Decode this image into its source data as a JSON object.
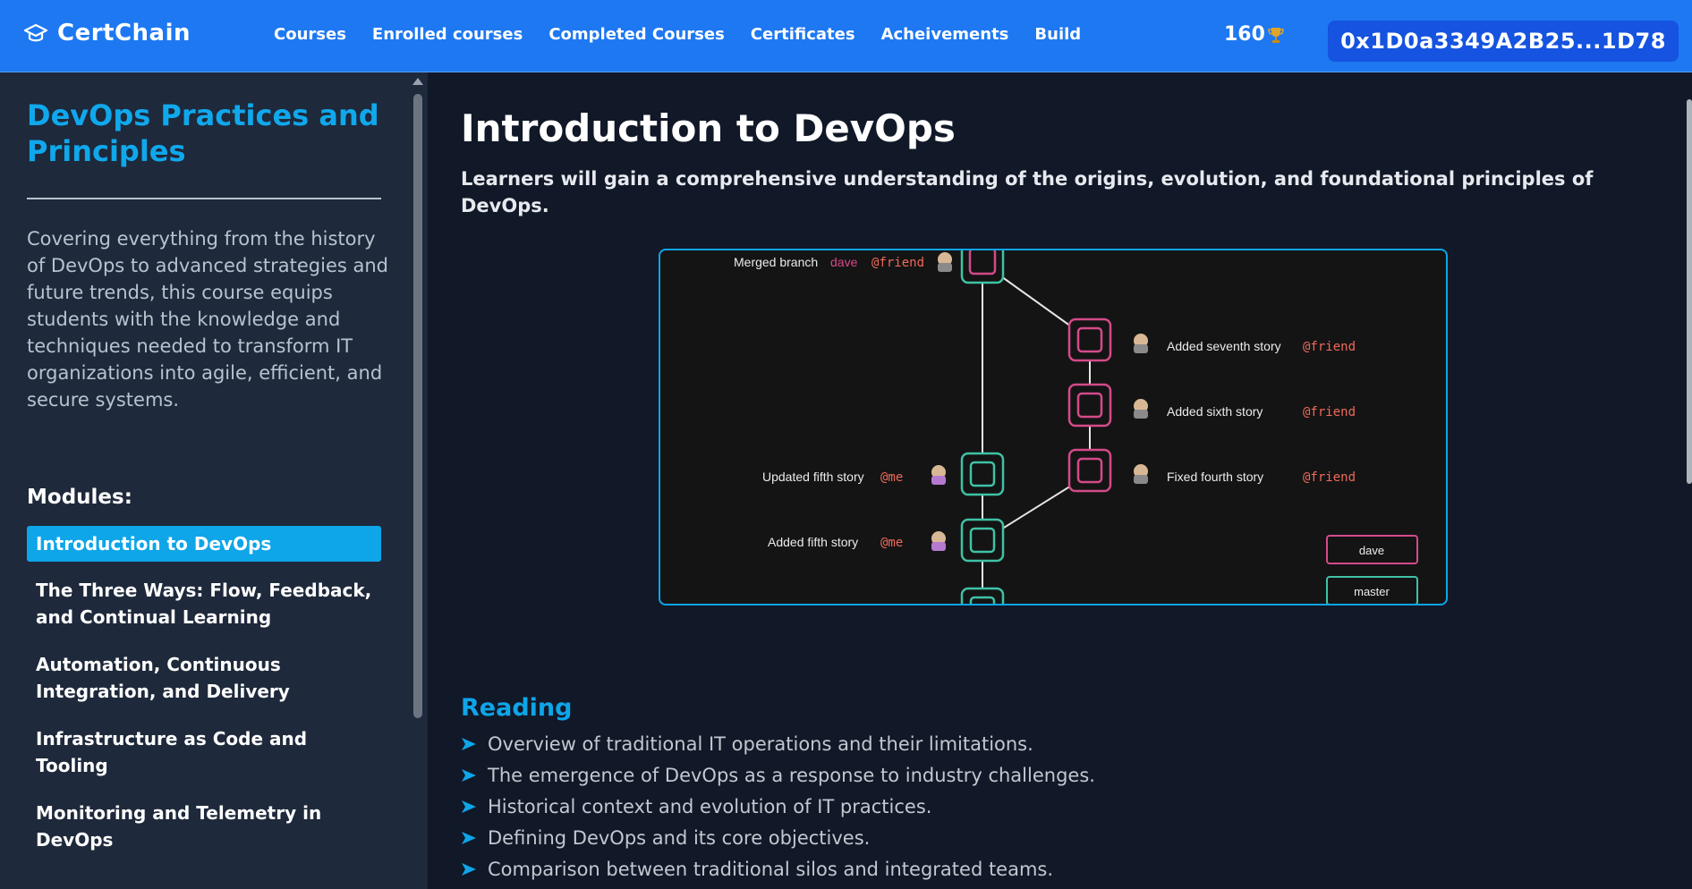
{
  "header": {
    "brand": "CertChain",
    "nav": [
      "Courses",
      "Enrolled courses",
      "Completed Courses",
      "Certificates",
      "Acheivements",
      "Build"
    ],
    "points": "160",
    "wallet": "0x1D0a3349A2B25...1D78"
  },
  "sidebar": {
    "course_title": "DevOps Practices and Principles",
    "description": "Covering everything from the history of DevOps to advanced strategies and future trends, this course equips students with the knowledge and techniques needed to transform IT organizations into agile, efficient, and secure systems.",
    "modules_heading": "Modules:",
    "modules": [
      "Introduction to DevOps",
      "The Three Ways: Flow, Feedback, and Continual Learning",
      "Automation, Continuous Integration, and Delivery",
      "Infrastructure as Code and Tooling",
      "Monitoring and Telemetry in DevOps"
    ]
  },
  "main": {
    "title": "Introduction to DevOps",
    "intro": "Learners will gain a comprehensive understanding of the origins, evolution, and foundational principles of DevOps.",
    "diagram": {
      "merged_text": "Merged branch",
      "merged_branch": "dave",
      "commits_right": [
        {
          "msg": "Added seventh story",
          "user": "@friend"
        },
        {
          "msg": "Added sixth story",
          "user": "@friend"
        },
        {
          "msg": "Fixed fourth story",
          "user": "@friend"
        }
      ],
      "commits_left": [
        {
          "msg": "Updated fifth story",
          "user": "@me"
        },
        {
          "msg": "Added fifth story",
          "user": "@me"
        }
      ],
      "merged_user": "@friend",
      "branches": [
        "dave",
        "master"
      ],
      "colors": {
        "dave": "#d44a8a",
        "master": "#3fc2a6",
        "user": "#ef6a5a"
      }
    },
    "reading_heading": "Reading",
    "reading": [
      "Overview of traditional IT operations and their limitations.",
      "The emergence of DevOps as a response to industry challenges.",
      "Historical context and evolution of IT practices.",
      "Defining DevOps and its core objectives.",
      "Comparison between traditional silos and integrated teams."
    ]
  }
}
